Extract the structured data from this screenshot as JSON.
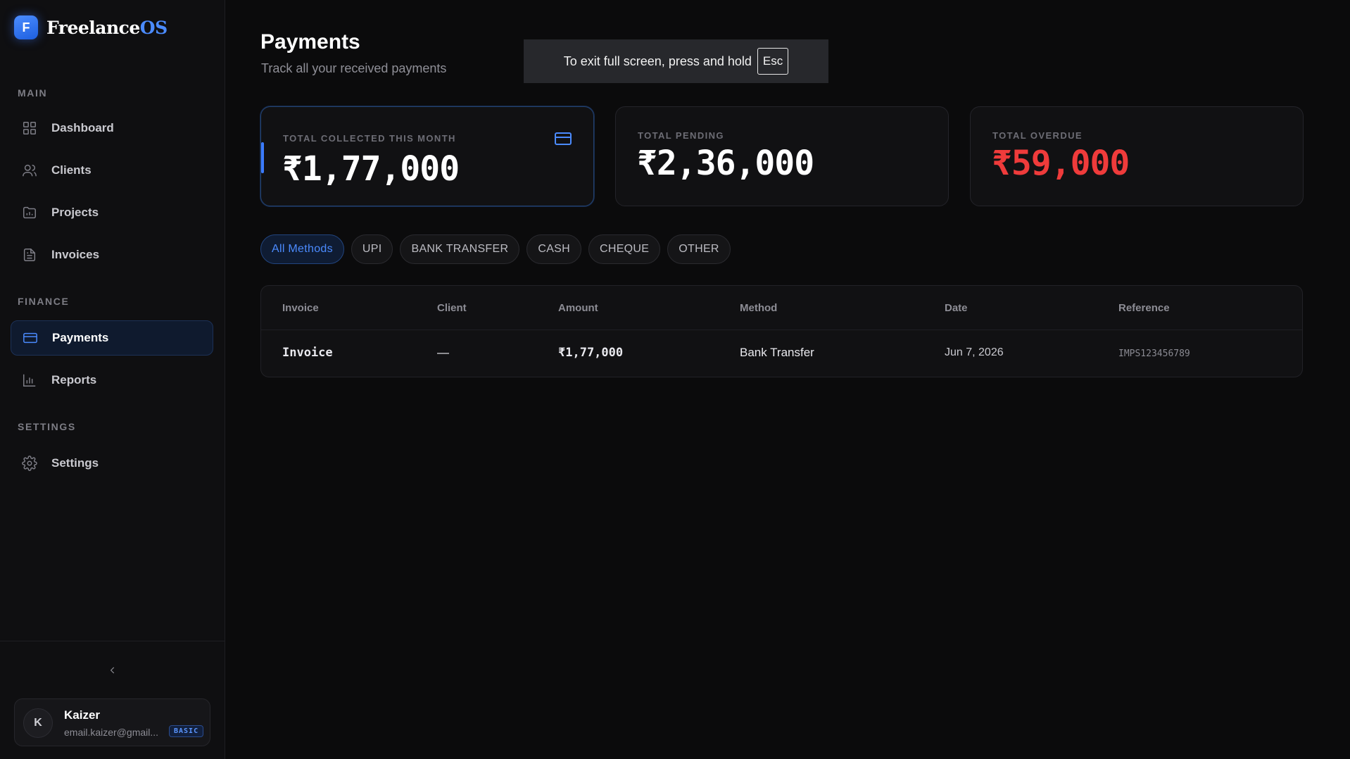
{
  "brand": {
    "logo_letter": "F",
    "name": "Freelance",
    "name_suffix": "OS"
  },
  "sidebar": {
    "sections": {
      "main": "MAIN",
      "finance": "FINANCE",
      "settings": "SETTINGS"
    },
    "items": [
      {
        "label": "Dashboard",
        "icon": "grid-icon"
      },
      {
        "label": "Clients",
        "icon": "users-icon"
      },
      {
        "label": "Projects",
        "icon": "folder-chart-icon"
      },
      {
        "label": "Invoices",
        "icon": "document-icon"
      },
      {
        "label": "Payments",
        "icon": "card-icon",
        "active": true
      },
      {
        "label": "Reports",
        "icon": "bar-chart-icon"
      },
      {
        "label": "Settings",
        "icon": "gear-icon"
      }
    ]
  },
  "user": {
    "avatar_initial": "K",
    "name": "Kaizer",
    "email": "email.kaizer@gmail...",
    "plan": "BASIC"
  },
  "page": {
    "title": "Payments",
    "subtitle": "Track all your received payments"
  },
  "fullscreen_toast": {
    "text": "To exit full screen, press and hold",
    "key": "Esc"
  },
  "stats": [
    {
      "label": "TOTAL COLLECTED THIS MONTH",
      "value": "₹1,77,000",
      "color": "#ffffff"
    },
    {
      "label": "TOTAL PENDING",
      "value": "₹2,36,000",
      "color": "#ffffff"
    },
    {
      "label": "TOTAL OVERDUE",
      "value": "₹59,000",
      "color": "#ef3b3b"
    }
  ],
  "filters": [
    "All Methods",
    "UPI",
    "BANK TRANSFER",
    "CASH",
    "CHEQUE",
    "OTHER"
  ],
  "table": {
    "columns": [
      "Invoice",
      "Client",
      "Amount",
      "Method",
      "Date",
      "Reference"
    ],
    "rows": [
      {
        "invoice": "Invoice",
        "client": "—",
        "amount": "₹1,77,000",
        "method": "Bank Transfer",
        "date": "Jun 7, 2026",
        "reference": "IMPS123456789"
      }
    ]
  },
  "colors": {
    "accent": "#4b8bff",
    "danger": "#ef3b3b",
    "background": "#0b0b0c"
  }
}
